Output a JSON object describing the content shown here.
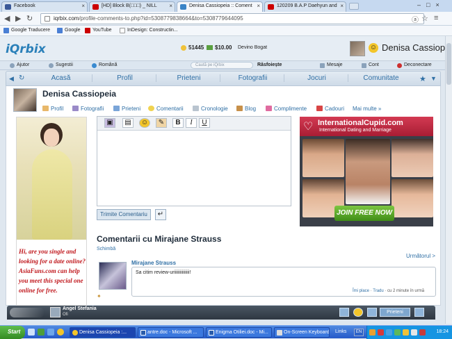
{
  "browser": {
    "tabs": [
      {
        "label": "Facebook",
        "color": "#3b5998"
      },
      {
        "label": "[HD] Block B(□□□) _ NILL",
        "color": "#cc0000"
      },
      {
        "label": "Denisa Cassiopeia :: Coment",
        "color": "#3a84c7",
        "active": true
      },
      {
        "label": "120209 B.A.P Daehyun and",
        "color": "#cc0000"
      }
    ],
    "url_host": "iqrbix.com",
    "url_path": "/profile-comments-to.php?id=5308779838664&to=5308779644095",
    "bookmarks": [
      {
        "label": "Google Traducere",
        "color": "#4a7fd4"
      },
      {
        "label": "Google",
        "color": "#4a7fd4"
      },
      {
        "label": "YouTube",
        "color": "#cc0000"
      },
      {
        "label": "InDesign: Constructin...",
        "color": "#dddddd"
      }
    ]
  },
  "site": {
    "logo": "iQrbix",
    "points": "51445",
    "money": "$10.00",
    "status": "Devino Bogat",
    "user_name": "Denisa Cassiope",
    "menu": [
      "Ajutor",
      "Sugestii",
      "Română"
    ],
    "search_placeholder": "Caută pe iQrbix",
    "browse": "Răsfoiește",
    "menu_right": [
      "Mesaje",
      "Cont",
      "Deconectare"
    ],
    "nav_tabs": [
      "Acasă",
      "Profil",
      "Prieteni",
      "Fotografii",
      "Jocuri",
      "Comunitate"
    ]
  },
  "profile": {
    "name": "Denisa Cassiopeia",
    "links": [
      "Profil",
      "Fotografii",
      "Prieteni",
      "Comentarii",
      "Cronologie",
      "Blog",
      "Complimente",
      "Cadouri",
      "Mai multe »"
    ]
  },
  "left_ad": {
    "text": "Hi, are you single and looking for a date online? AsiaFuns.com can help you meet this special one online for free."
  },
  "editor": {
    "bold": "B",
    "italic": "I",
    "underline": "U",
    "send_label": "Trimite Comentariu"
  },
  "comments": {
    "title": "Comentarii cu Mirajane Strauss",
    "change": "Schimbă",
    "next": "Următorul >",
    "author": "Mirajane Strauss",
    "text": "Sa citim review-uriiiiiiiiiiiiii!",
    "like": "Îmi place",
    "translate": "Tradu",
    "time": "cu 2 minute în urmă"
  },
  "right_ad": {
    "brand": "InternationalCupid.com",
    "tagline": "International Dating and Marriage",
    "cta": "JOIN FREE NOW"
  },
  "chat": {
    "name": "Angel Stefania",
    "status": "Ofi",
    "button": "Prieteni"
  },
  "taskbar": {
    "start": "Start",
    "tasks": [
      {
        "label": "Denisa Cassiopeia :...",
        "color": "#3a84c7"
      },
      {
        "label": "antre.doc - Microsoft ...",
        "color": "#2a5caa"
      },
      {
        "label": "Enigma Otiliei.doc - Mi...",
        "color": "#2a5caa"
      },
      {
        "label": "On-Screen Keyboard",
        "color": "#dddddd"
      }
    ],
    "links": "Links",
    "lang": "EN",
    "clock": "18:24"
  }
}
